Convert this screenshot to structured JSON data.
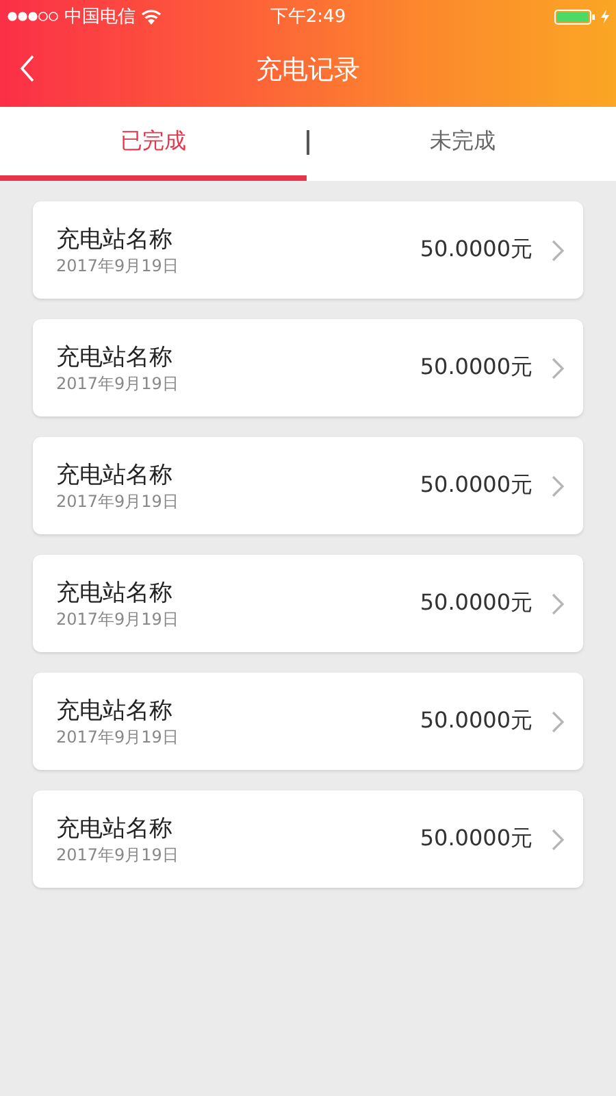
{
  "status_bar": {
    "carrier": "中国电信",
    "time": "下午2:49"
  },
  "nav": {
    "title": "充电记录"
  },
  "tabs": [
    {
      "label": "已完成",
      "selected": true
    },
    {
      "label": "未完成",
      "selected": false
    }
  ],
  "records": [
    {
      "name": "充电站名称",
      "date": "2017年9月19日",
      "amount": "50.0000元"
    },
    {
      "name": "充电站名称",
      "date": "2017年9月19日",
      "amount": "50.0000元"
    },
    {
      "name": "充电站名称",
      "date": "2017年9月19日",
      "amount": "50.0000元"
    },
    {
      "name": "充电站名称",
      "date": "2017年9月19日",
      "amount": "50.0000元"
    },
    {
      "name": "充电站名称",
      "date": "2017年9月19日",
      "amount": "50.0000元"
    },
    {
      "name": "充电站名称",
      "date": "2017年9月19日",
      "amount": "50.0000元"
    }
  ]
}
